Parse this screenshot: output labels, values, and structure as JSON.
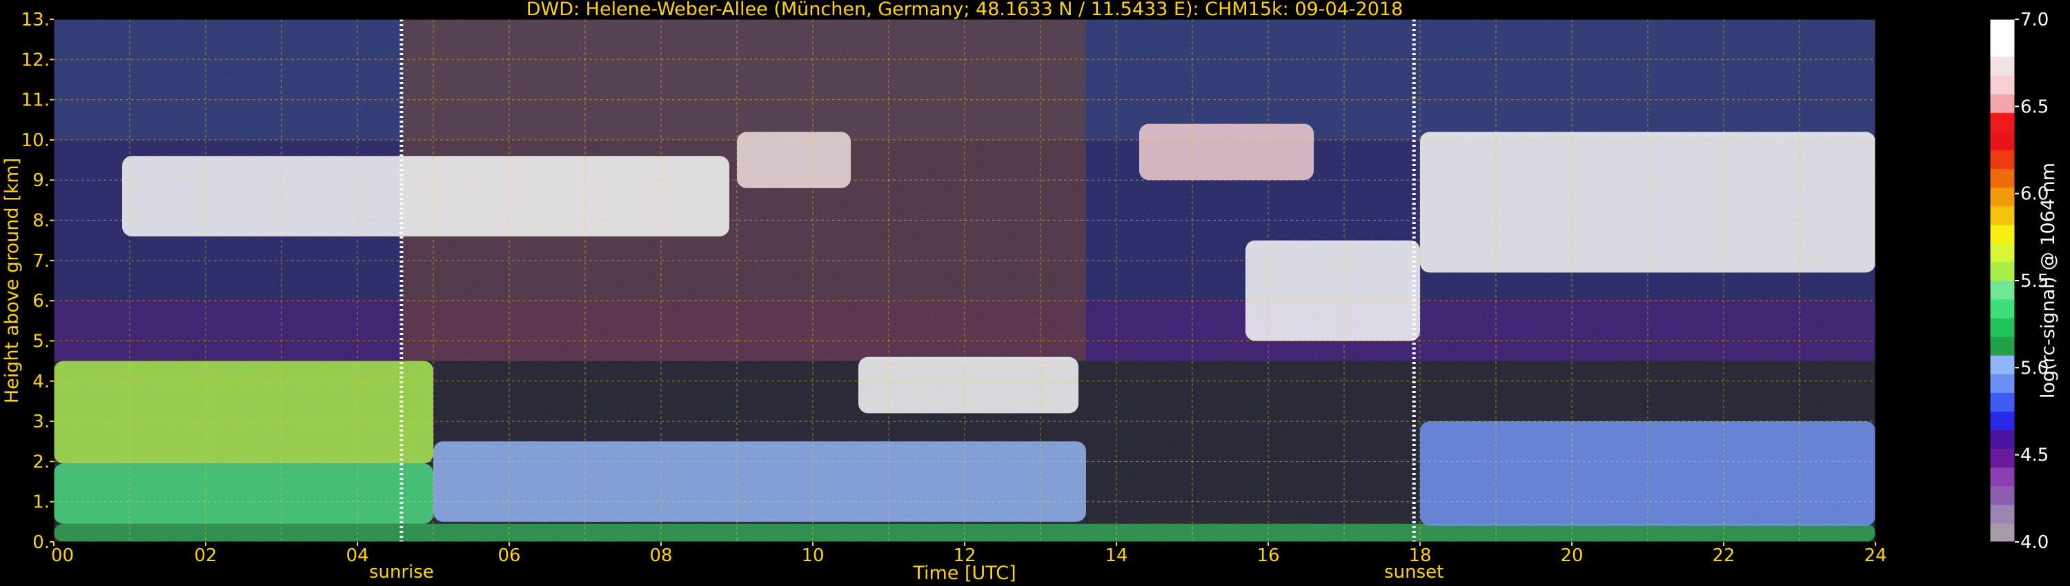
{
  "chart_data": {
    "type": "heatmap",
    "title": "DWD: Helene-Weber-Allee (München, Germany; 48.1633 N / 11.5433 E):    CHM15k: 09-04-2018",
    "xlabel": "Time [UTC]",
    "ylabel": "Height above ground [km]",
    "xlim": [
      0,
      24
    ],
    "ylim": [
      0,
      13
    ],
    "xticks": [
      "00",
      "02",
      "04",
      "06",
      "08",
      "10",
      "12",
      "14",
      "16",
      "18",
      "20",
      "22",
      "24"
    ],
    "yticks": [
      "0.",
      "1.",
      "2.",
      "3.",
      "4.",
      "5.",
      "6.",
      "7.",
      "8.",
      "9.",
      "10.",
      "11.",
      "12.",
      "13."
    ],
    "grid": true,
    "colorbar": {
      "label": "log(rc-signal) @ 1064 nm",
      "min": 4.0,
      "max": 7.0,
      "ticks": [
        "4.0",
        "4.5",
        "5.0",
        "5.5",
        "6.0",
        "6.5",
        "7.0"
      ],
      "colors": [
        "#a89aaa",
        "#9d84b3",
        "#8c5eb0",
        "#8b3fb0",
        "#6a1a9a",
        "#4a14a0",
        "#2a2ae6",
        "#3d5df2",
        "#6a8ff5",
        "#8fb4f7",
        "#25a04a",
        "#22c35a",
        "#3fdc7a",
        "#72e695",
        "#a9ee48",
        "#d8f537",
        "#f8ef10",
        "#f3c20d",
        "#f09a0c",
        "#ee6b0b",
        "#ec3b14",
        "#e8141a",
        "#f0191b",
        "#f2a5aa",
        "#f7cfd2",
        "#f2e2e4",
        "#ffffff",
        "#ffffff"
      ]
    },
    "markers": [
      {
        "name": "sunrise",
        "x": 4.58
      },
      {
        "name": "sunset",
        "x": 17.92
      }
    ],
    "layers": [
      {
        "name": "boundary-layer",
        "x_start": 0,
        "x_end": 24,
        "y_bottom": 0.0,
        "y_top": 0.45,
        "level": 5.1
      },
      {
        "name": "residual-layer",
        "x_start": 0,
        "x_end": 5.0,
        "y_bottom": 0.45,
        "y_top": 1.95,
        "level": 5.3
      },
      {
        "name": "aerosol-layer",
        "x_start": 0,
        "x_end": 5.0,
        "y_bottom": 1.95,
        "y_top": 4.5,
        "level": 5.55
      },
      {
        "name": "aerosol-layer-day",
        "x_start": 5.0,
        "x_end": 13.6,
        "y_bottom": 0.5,
        "y_top": 2.5,
        "level": 5.0
      },
      {
        "name": "aerosol-layer-evening",
        "x_start": 18.0,
        "x_end": 24,
        "y_bottom": 0.4,
        "y_top": 3.0,
        "level": 4.9
      },
      {
        "name": "cirrus",
        "x_start": 0.9,
        "x_end": 8.9,
        "y_bottom": 7.6,
        "y_top": 9.6,
        "level": 6.8
      },
      {
        "name": "cirrus-midday",
        "x_start": 9.0,
        "x_end": 10.5,
        "y_bottom": 8.8,
        "y_top": 10.2,
        "level": 6.7
      },
      {
        "name": "cirrus-afternoon",
        "x_start": 14.3,
        "x_end": 16.6,
        "y_bottom": 9.0,
        "y_top": 10.4,
        "level": 6.6
      },
      {
        "name": "cloud",
        "x_start": 10.6,
        "x_end": 13.5,
        "y_bottom": 3.2,
        "y_top": 4.6,
        "level": 7.0
      },
      {
        "name": "cloud-descending",
        "x_start": 15.7,
        "x_end": 18.0,
        "y_bottom": 5.0,
        "y_top": 7.5,
        "level": 6.9
      },
      {
        "name": "cloud-rising",
        "x_start": 18.0,
        "x_end": 24,
        "y_bottom": 6.7,
        "y_top": 10.2,
        "level": 6.8
      }
    ]
  }
}
